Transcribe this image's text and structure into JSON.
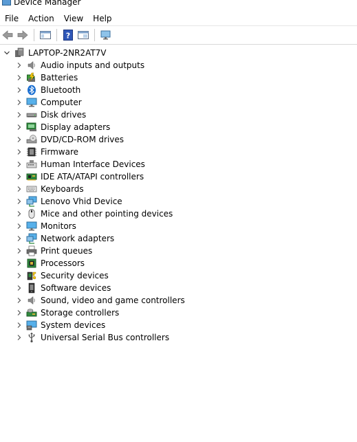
{
  "window": {
    "title": "Device Manager"
  },
  "menu": [
    "File",
    "Action",
    "View",
    "Help"
  ],
  "tree": {
    "root": "LAPTOP-2NR2AT7V",
    "items": [
      {
        "label": "Audio inputs and outputs",
        "icon": "speaker-icon"
      },
      {
        "label": "Batteries",
        "icon": "battery-icon"
      },
      {
        "label": "Bluetooth",
        "icon": "bluetooth-icon"
      },
      {
        "label": "Computer",
        "icon": "computer-icon"
      },
      {
        "label": "Disk drives",
        "icon": "disk-drive-icon"
      },
      {
        "label": "Display adapters",
        "icon": "display-adapter-icon"
      },
      {
        "label": "DVD/CD-ROM drives",
        "icon": "dvd-drive-icon"
      },
      {
        "label": "Firmware",
        "icon": "firmware-chip-icon"
      },
      {
        "label": "Human Interface Devices",
        "icon": "hid-icon"
      },
      {
        "label": "IDE ATA/ATAPI controllers",
        "icon": "ide-controller-icon"
      },
      {
        "label": "Keyboards",
        "icon": "keyboard-icon"
      },
      {
        "label": "Lenovo Vhid Device",
        "icon": "network-monitor-icon"
      },
      {
        "label": "Mice and other pointing devices",
        "icon": "mouse-icon"
      },
      {
        "label": "Monitors",
        "icon": "monitor-icon"
      },
      {
        "label": "Network adapters",
        "icon": "network-adapter-icon"
      },
      {
        "label": "Print queues",
        "icon": "printer-icon"
      },
      {
        "label": "Processors",
        "icon": "processor-icon"
      },
      {
        "label": "Security devices",
        "icon": "security-device-icon"
      },
      {
        "label": "Software devices",
        "icon": "software-device-icon"
      },
      {
        "label": "Sound, video and game controllers",
        "icon": "speaker-icon"
      },
      {
        "label": "Storage controllers",
        "icon": "storage-controller-icon"
      },
      {
        "label": "System devices",
        "icon": "system-device-icon"
      },
      {
        "label": "Universal Serial Bus controllers",
        "icon": "usb-icon"
      }
    ]
  }
}
